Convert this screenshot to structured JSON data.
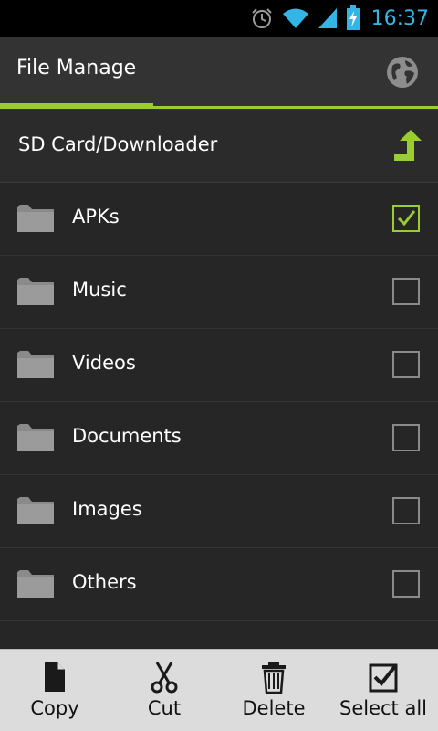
{
  "status_bar": {
    "time": "16:37",
    "icons": [
      "alarm-icon",
      "wifi-icon",
      "signal-icon",
      "battery-charging-icon"
    ]
  },
  "action_bar": {
    "title": "File Manage",
    "globe_icon": "globe-icon",
    "accent_color": "#9acd32"
  },
  "path": {
    "text": "SD Card/Downloader",
    "up_icon": "up-folder-icon"
  },
  "files": [
    {
      "name": "APKs",
      "checked": true
    },
    {
      "name": "Music",
      "checked": false
    },
    {
      "name": "Videos",
      "checked": false
    },
    {
      "name": "Documents",
      "checked": false
    },
    {
      "name": "Images",
      "checked": false
    },
    {
      "name": "Others",
      "checked": false
    }
  ],
  "bottom_bar": {
    "copy": "Copy",
    "cut": "Cut",
    "delete": "Delete",
    "select_all": "Select all"
  }
}
